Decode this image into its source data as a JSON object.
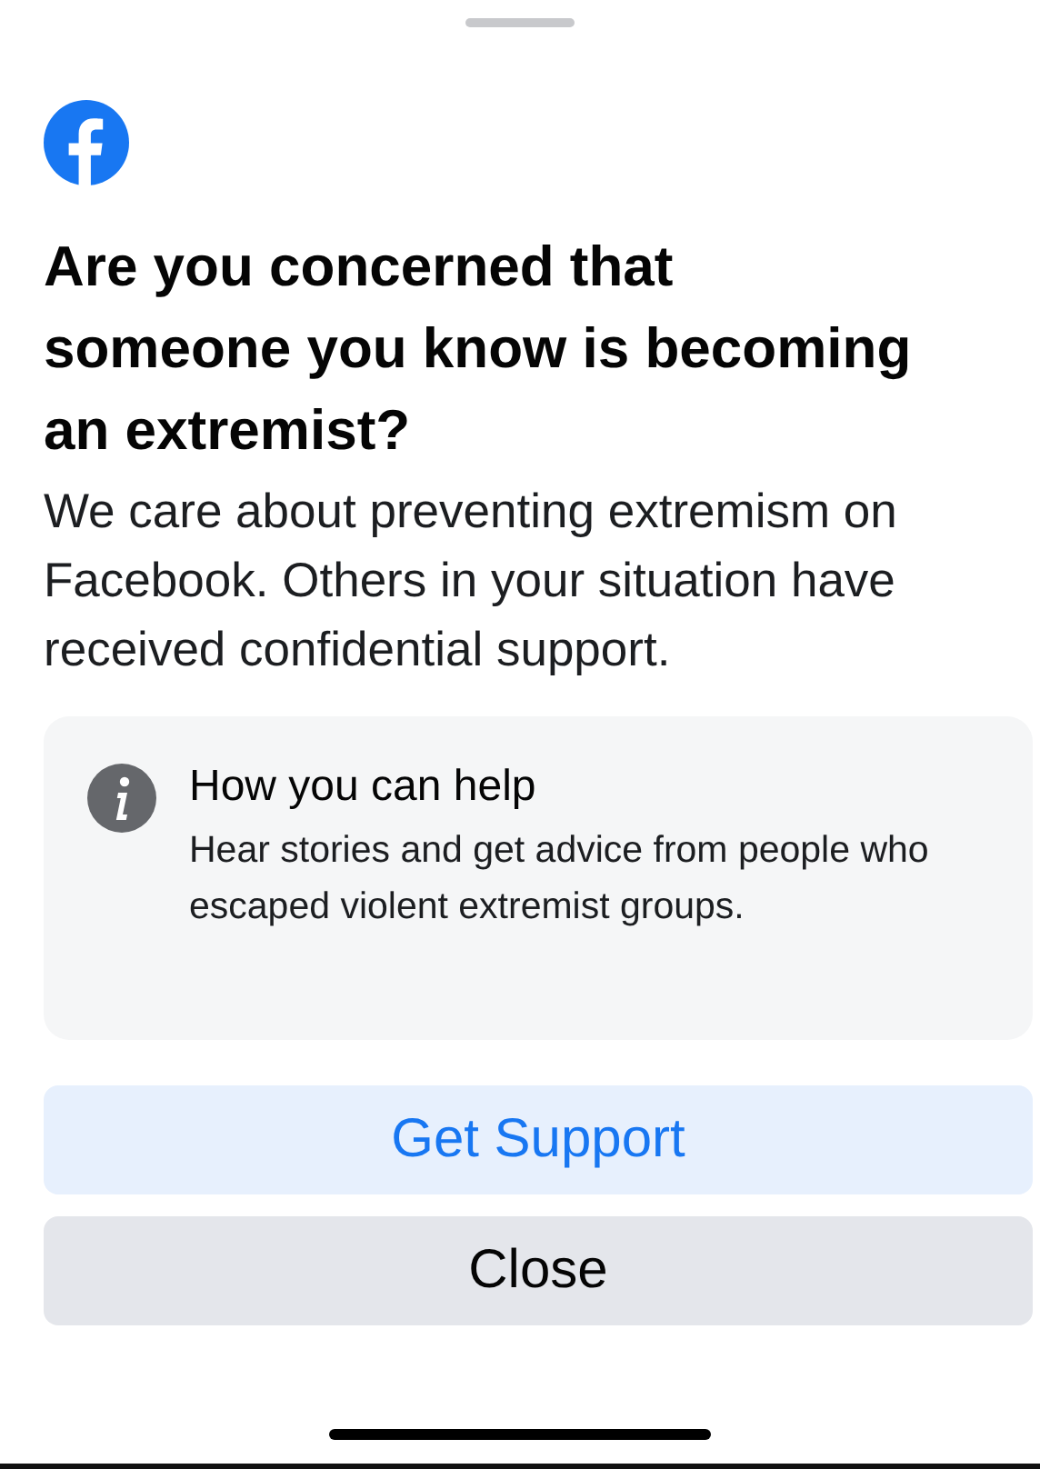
{
  "title": "Are you concerned that someone you know is becoming an extremist?",
  "description": "We care about preventing extremism on Facebook. Others in your situation have received confidential support.",
  "info_card": {
    "heading": "How you can help",
    "body": "Hear stories and get advice from people who escaped violent extremist groups."
  },
  "buttons": [
    {
      "label": "Get Support",
      "kind": "primary"
    },
    {
      "label": "Close",
      "kind": "secondary"
    }
  ]
}
